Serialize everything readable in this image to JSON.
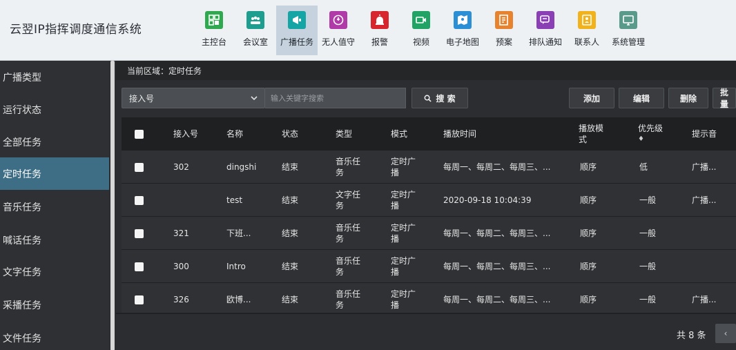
{
  "app": {
    "title": "云翌IP指挥调度通信系统"
  },
  "nav": [
    {
      "label": "主控台",
      "icon": "dashboard-icon",
      "color": "#2fa84f"
    },
    {
      "label": "会议室",
      "icon": "meeting-icon",
      "color": "#1e9e8e"
    },
    {
      "label": "广播任务",
      "icon": "megaphone-icon",
      "color": "#16a5a5",
      "active": true
    },
    {
      "label": "无人值守",
      "icon": "unattended-icon",
      "color": "#b03aa8"
    },
    {
      "label": "报警",
      "icon": "alarm-icon",
      "color": "#d8262e"
    },
    {
      "label": "视频",
      "icon": "video-icon",
      "color": "#21a365"
    },
    {
      "label": "电子地图",
      "icon": "map-icon",
      "color": "#2b8fd6"
    },
    {
      "label": "预案",
      "icon": "plan-icon",
      "color": "#e7832e"
    },
    {
      "label": "排队通知",
      "icon": "queue-icon",
      "color": "#8b3fb5"
    },
    {
      "label": "联系人",
      "icon": "contacts-icon",
      "color": "#f1b21b"
    },
    {
      "label": "系统管理",
      "icon": "system-icon",
      "color": "#5a9a8a"
    }
  ],
  "sidebar": {
    "items": [
      {
        "label": "广播类型"
      },
      {
        "label": "运行状态"
      },
      {
        "label": "全部任务"
      },
      {
        "label": "定时任务",
        "active": true
      },
      {
        "label": "音乐任务"
      },
      {
        "label": "喊话任务"
      },
      {
        "label": "文字任务"
      },
      {
        "label": "采播任务"
      },
      {
        "label": "文件任务"
      }
    ]
  },
  "area": {
    "label": "当前区域：",
    "value": "定时任务"
  },
  "toolbar": {
    "select_value": "接入号",
    "search_placeholder": "输入关键字搜索",
    "search_label": "搜 索",
    "add_label": "添加",
    "edit_label": "编辑",
    "delete_label": "删除",
    "batch_label": "批量"
  },
  "table": {
    "headers": {
      "ext": "接入号",
      "name": "名称",
      "status": "状态",
      "type": "类型",
      "mode": "模式",
      "time": "播放时间",
      "play_mode": "播放模式",
      "priority": "优先级",
      "sort_mark": "♦",
      "tone": "提示音"
    },
    "rows": [
      {
        "ext": "302",
        "name": "dingshi",
        "status": "结束",
        "type": "音乐任务",
        "mode": "定时广播",
        "time": "每周一、每周二、每周三、...",
        "play_mode": "顺序",
        "priority": "低",
        "tone": "广播..."
      },
      {
        "ext": "",
        "name": "test",
        "status": "结束",
        "type": "文字任务",
        "mode": "定时广播",
        "time": "2020-09-18 10:04:39",
        "play_mode": "顺序",
        "priority": "一般",
        "tone": "广播..."
      },
      {
        "ext": "321",
        "name": "下班...",
        "status": "结束",
        "type": "音乐任务",
        "mode": "定时广播",
        "time": "每周一、每周二、每周三、...",
        "play_mode": "顺序",
        "priority": "一般",
        "tone": ""
      },
      {
        "ext": "300",
        "name": "Intro",
        "status": "结束",
        "type": "音乐任务",
        "mode": "定时广播",
        "time": "每周一、每周二、每周三、...",
        "play_mode": "顺序",
        "priority": "一般",
        "tone": ""
      },
      {
        "ext": "326",
        "name": "欧博...",
        "status": "结束",
        "type": "音乐任务",
        "mode": "定时广播",
        "time": "每周一、每周二、每周三、...",
        "play_mode": "顺序",
        "priority": "一般",
        "tone": "广播..."
      }
    ]
  },
  "pagination": {
    "total": "共 8 条",
    "prev": "‹"
  }
}
